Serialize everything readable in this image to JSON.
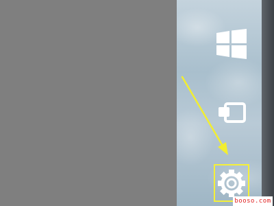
{
  "charms": {
    "start": {
      "icon": "windows-logo-icon"
    },
    "devices": {
      "icon": "devices-icon"
    },
    "settings": {
      "icon": "gear-icon",
      "highlighted": true
    }
  },
  "annotation": {
    "arrow_icon": "arrow-icon",
    "arrow_color": "#f2ee30",
    "highlight_color": "#f5f038"
  },
  "watermark": {
    "text": "booso.com"
  },
  "colors": {
    "background_gray": "#7f7f7f",
    "charms_icon": "#ffffff"
  }
}
